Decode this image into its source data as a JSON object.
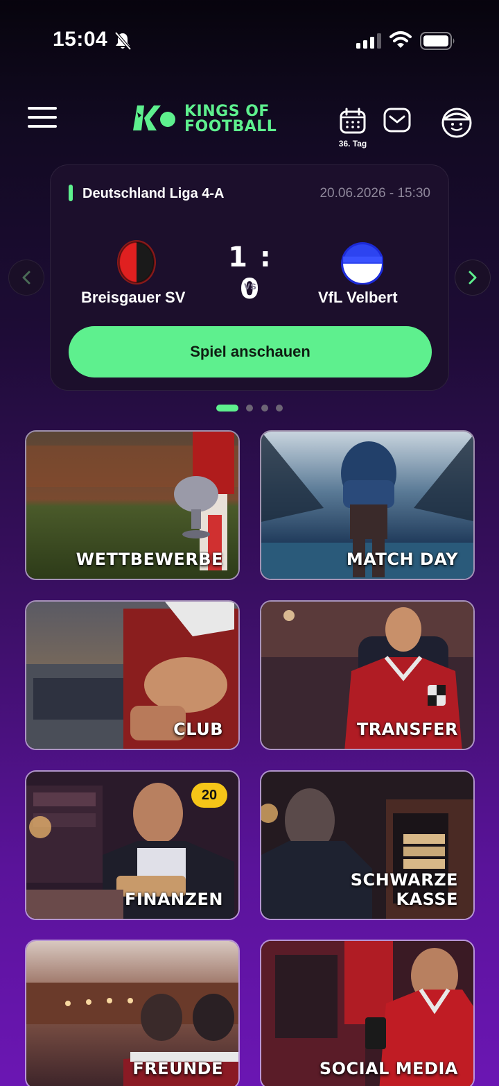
{
  "status_bar": {
    "time": "15:04"
  },
  "header": {
    "logo_line1": "KINGS OF",
    "logo_line2": "FOOTBALL",
    "calendar_label": "36. Tag"
  },
  "match": {
    "league": "Deutschland Liga 4-A",
    "datetime": "20.06.2026 - 15:30",
    "home_team": "Breisgauer SV",
    "away_team": "VfL Velbert",
    "score": "1 : 0",
    "vs": "vs",
    "watch_button": "Spiel anschauen"
  },
  "carousel": {
    "page_count": 4,
    "active_index": 0
  },
  "tiles": [
    {
      "label": "WETTBEWERBE"
    },
    {
      "label": "MATCH DAY"
    },
    {
      "label": "CLUB"
    },
    {
      "label": "TRANSFER"
    },
    {
      "label": "FINANZEN",
      "badge": "20"
    },
    {
      "label_line1": "SCHWARZE",
      "label_line2": "KASSE"
    },
    {
      "label": "FREUNDE"
    },
    {
      "label": "SOCIAL MEDIA"
    }
  ],
  "colors": {
    "accent": "#5ef08e",
    "badge": "#f5c518",
    "card": "#1c0f2c"
  }
}
